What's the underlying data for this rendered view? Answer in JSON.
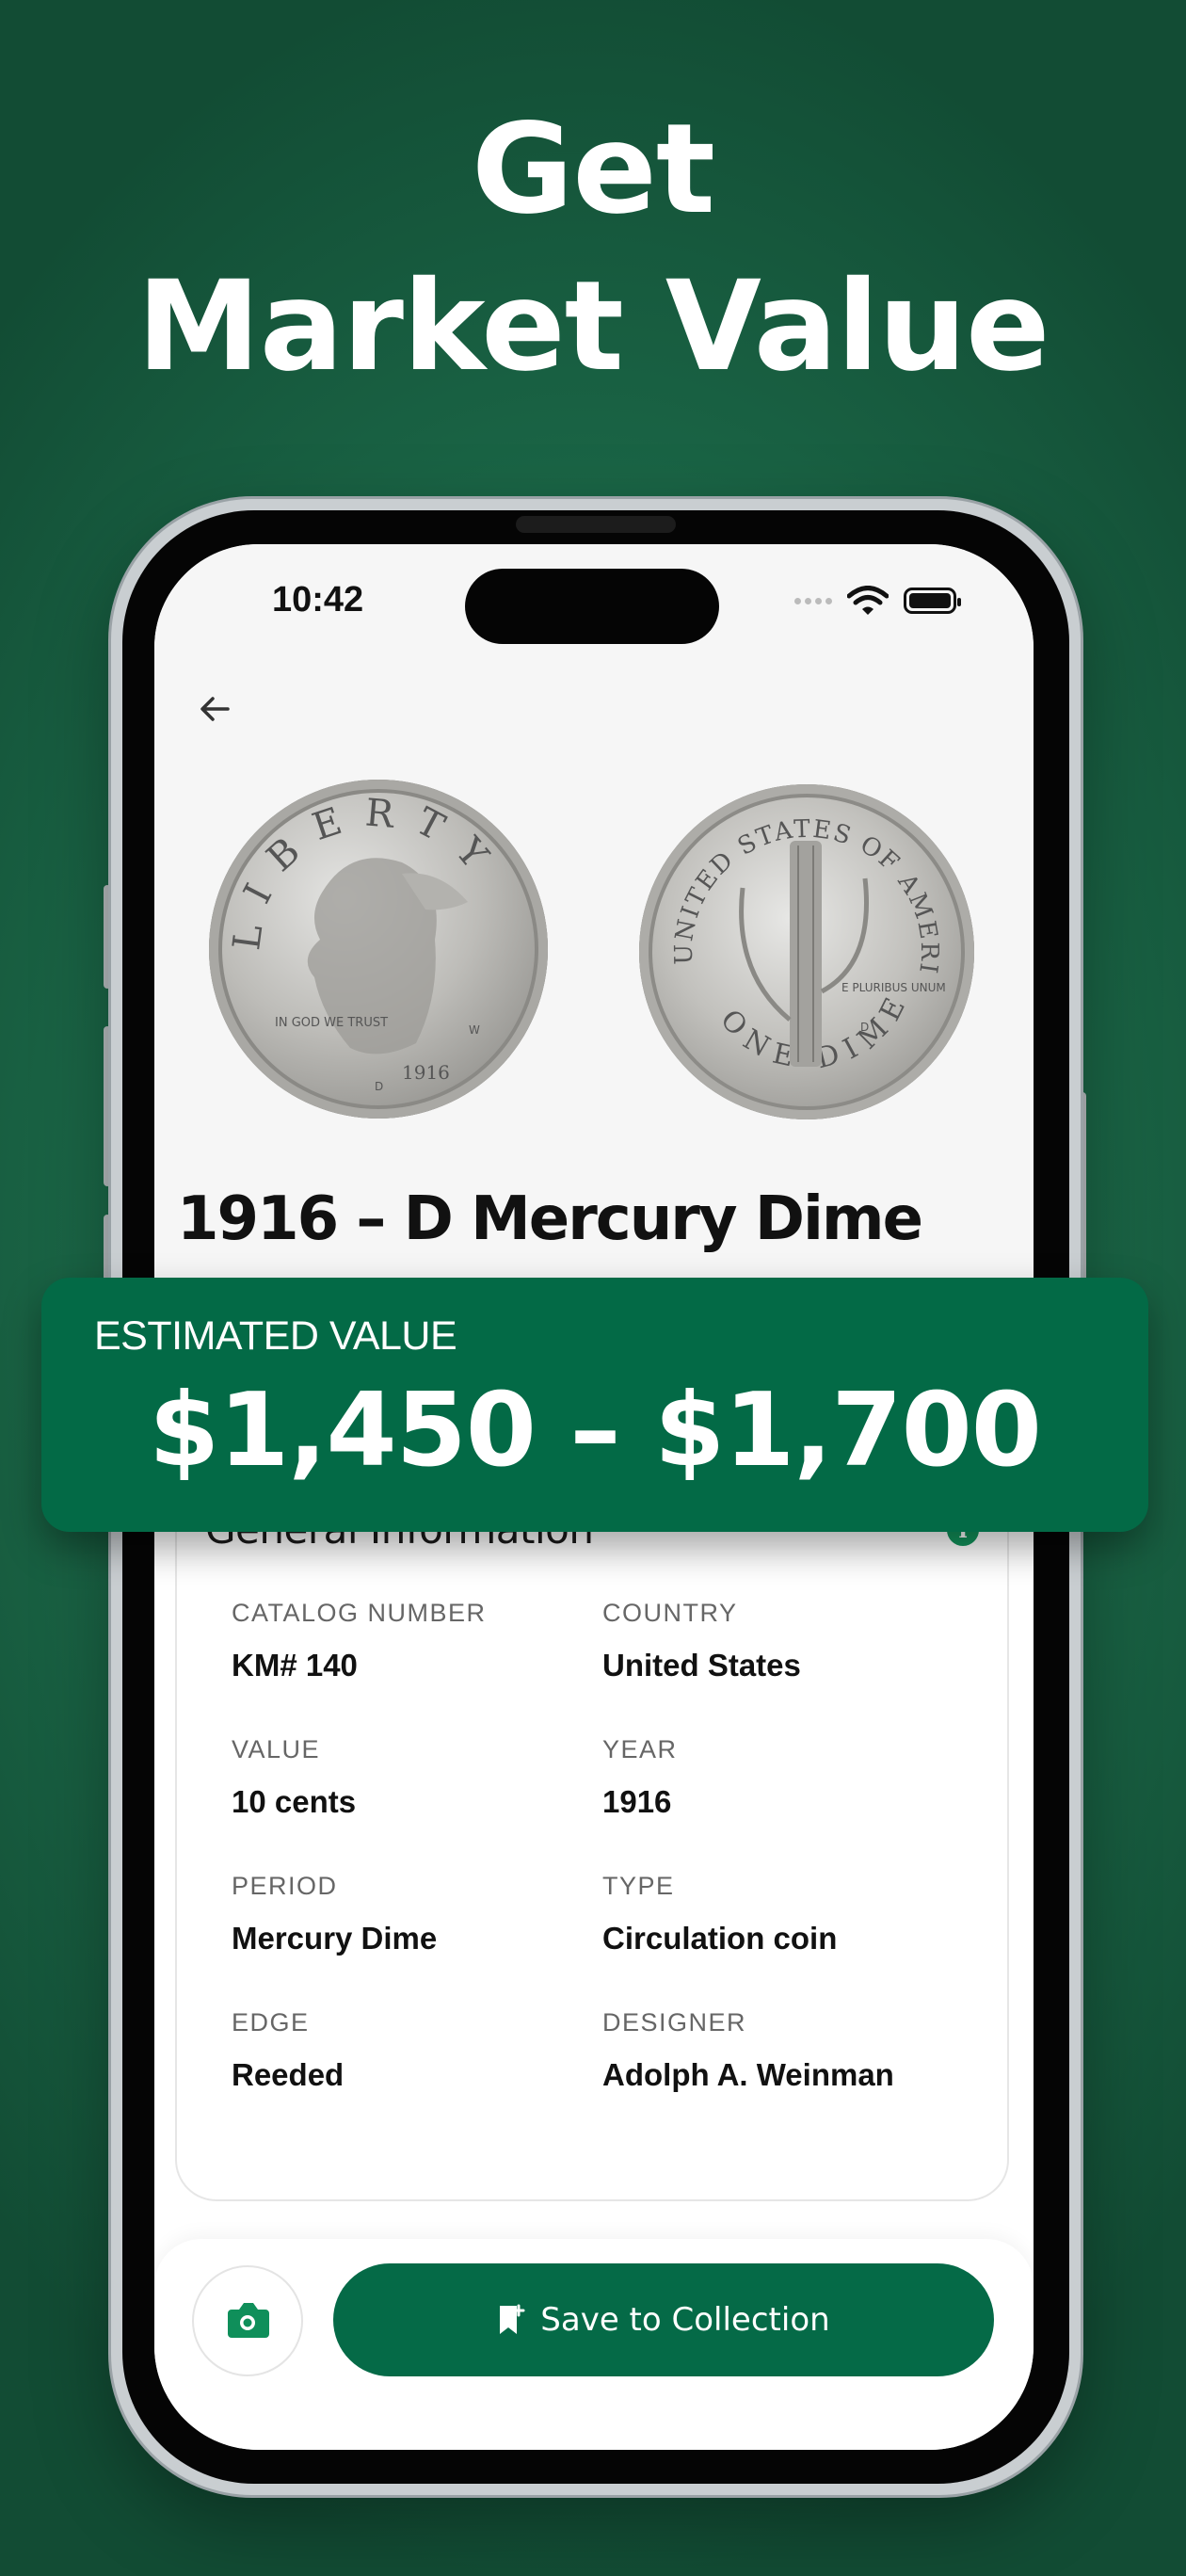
{
  "headline": {
    "line1": "Get",
    "line2": "Market Value"
  },
  "status_bar": {
    "time": "10:42"
  },
  "coin": {
    "title": "1916 – D Mercury Dime"
  },
  "estimate": {
    "label": "ESTIMATED VALUE",
    "value": "$1,450 – $1,700"
  },
  "general_info": {
    "title": "General Information",
    "info_icon": "i",
    "fields": [
      {
        "label": "CATALOG NUMBER",
        "value": "KM# 140"
      },
      {
        "label": "COUNTRY",
        "value": "United States"
      },
      {
        "label": "VALUE",
        "value": "10 cents"
      },
      {
        "label": "YEAR",
        "value": "1916"
      },
      {
        "label": "PERIOD",
        "value": "Mercury Dime"
      },
      {
        "label": "TYPE",
        "value": "Circulation coin"
      },
      {
        "label": "EDGE",
        "value": "Reeded"
      },
      {
        "label": "DESIGNER",
        "value": "Adolph A. Weinman"
      }
    ]
  },
  "bottom_bar": {
    "save_label": "Save to Collection"
  },
  "coin_front_text": {
    "legend": "LIBERTY",
    "motto": "IN GOD WE TRUST",
    "date": "1916",
    "mint": "D",
    "designer_mark": "W"
  },
  "coin_back_text": {
    "legend": "UNITED STATES OF AMERICA",
    "denomination": "ONE DIME",
    "motto": "E PLURIBUS UNUM",
    "mint": "D"
  },
  "colors": {
    "brand_green": "#056a47",
    "background_green": "#1d6e4c",
    "info_icon": "#12945c"
  }
}
